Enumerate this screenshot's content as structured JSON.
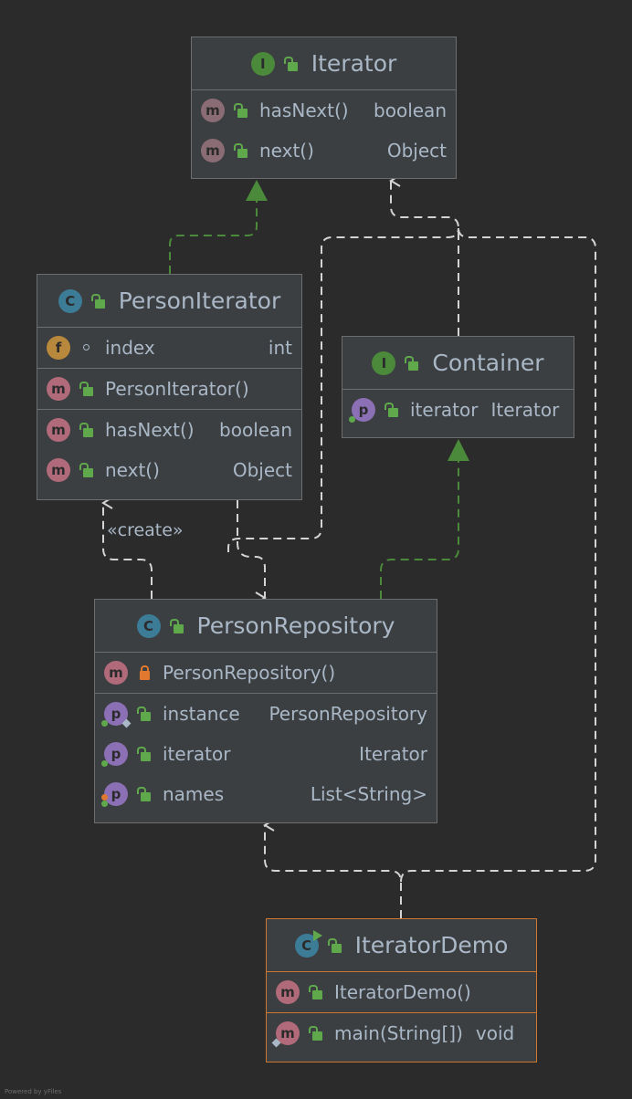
{
  "colors": {
    "background": "#2b2b2b",
    "node_fill": "#3c3f41",
    "node_border": "#6e6e6e",
    "selected_border": "#cc7832",
    "realization_edge": "#4a8a3a",
    "dependency_edge": "#d4d4d4"
  },
  "nodes": {
    "iterator": {
      "title": "Iterator",
      "kind_icon": "I",
      "rows": [
        {
          "icon": "m",
          "name": "hasNext()",
          "type": "boolean"
        },
        {
          "icon": "m",
          "name": "next()",
          "type": "Object"
        }
      ]
    },
    "person_iterator": {
      "title": "PersonIterator",
      "kind_icon": "C",
      "fields": [
        {
          "icon": "f",
          "name": "index",
          "type": "int"
        }
      ],
      "constructors": [
        {
          "icon": "m",
          "name": "PersonIterator()"
        }
      ],
      "methods": [
        {
          "icon": "m",
          "name": "hasNext()",
          "type": "boolean"
        },
        {
          "icon": "m",
          "name": "next()",
          "type": "Object"
        }
      ]
    },
    "container": {
      "title": "Container",
      "kind_icon": "I",
      "rows": [
        {
          "icon": "p",
          "name": "iterator",
          "type": "Iterator"
        }
      ]
    },
    "person_repository": {
      "title": "PersonRepository",
      "kind_icon": "C",
      "constructors": [
        {
          "icon": "m",
          "name": "PersonRepository()"
        }
      ],
      "properties": [
        {
          "icon": "p",
          "name": "instance",
          "type": "PersonRepository"
        },
        {
          "icon": "p",
          "name": "iterator",
          "type": "Iterator"
        },
        {
          "icon": "p",
          "name": "names",
          "type": "List<String>"
        }
      ]
    },
    "iterator_demo": {
      "title": "IteratorDemo",
      "kind_icon": "C",
      "constructors": [
        {
          "icon": "m",
          "name": "IteratorDemo()"
        }
      ],
      "methods": [
        {
          "icon": "m",
          "name": "main(String[])",
          "type": "void"
        }
      ]
    }
  },
  "edges": {
    "create_label": "«create»"
  },
  "watermark": "Powered by yFiles"
}
